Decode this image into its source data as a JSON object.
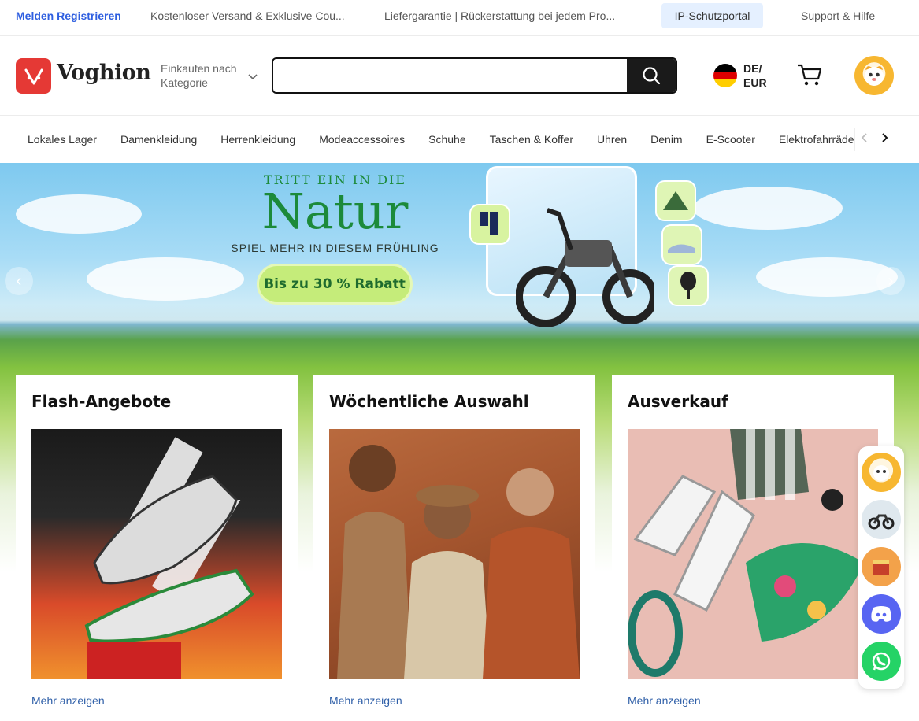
{
  "topbar": {
    "auth_label": "Melden Registrieren",
    "promo1": "Kostenloser Versand & Exklusive Cou...",
    "promo2": "Liefergarantie | Rückerstattung bei jedem Pro...",
    "ip_portal": "IP-Schutzportal",
    "support": "Support & Hilfe"
  },
  "header": {
    "logo_text": "Voghion",
    "category_label": "Einkaufen nach Kategorie",
    "search_placeholder": "",
    "search_value": "",
    "language": "DE/",
    "currency": "EUR"
  },
  "nav": {
    "categories": [
      "Lokales Lager",
      "Damenkleidung",
      "Herrenkleidung",
      "Modeaccessoires",
      "Schuhe",
      "Taschen & Koffer",
      "Uhren",
      "Denim",
      "E-Scooter",
      "Elektrofahrräder"
    ]
  },
  "banner": {
    "line1": "TRITT EIN IN DIE",
    "headline": "Natur",
    "subline": "SPIEL MEHR IN DIESEM FRÜHLING",
    "promo": "Bis zu 30 % Rabatt"
  },
  "cards": [
    {
      "title": "Flash-Angebote",
      "more": "Mehr anzeigen"
    },
    {
      "title": "Wöchentliche Auswahl",
      "more": "Mehr anzeigen"
    },
    {
      "title": "Ausverkauf",
      "more": "Mehr anzeigen"
    }
  ],
  "colors": {
    "accent_blue": "#2f5fe0",
    "brand_red": "#e53935",
    "ip_badge_bg": "#e5f0ff",
    "discord": "#5865f2",
    "whatsapp": "#25d366"
  },
  "icons": {
    "search": "search-icon",
    "cart": "cart-icon",
    "chevron": "chevron-down-icon"
  }
}
